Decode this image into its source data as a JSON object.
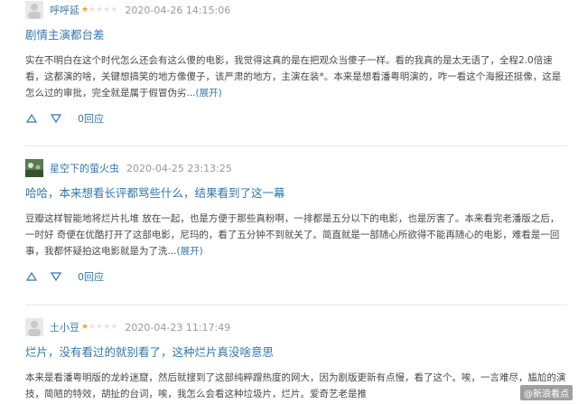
{
  "reviews": [
    {
      "author": "呼呼延",
      "rating": 1,
      "date": "2020-04-26 14:15:06",
      "title": "剧情主演都台差",
      "content": "实在不明白在这个时代怎么还会有这么傻的电影，我觉得这真的是在把观众当傻子一样。看的我真的是太无语了，全程2.0倍速看，这都演的啥，关键想搞笑的地方像傻子，该严肃的地方，主演在装*。本来是想看潘粤明演的，咋一看这个海报还挺像，这是怎么过的审批，完全就是属于假冒伪劣...",
      "more": "(展开)",
      "replies": "0回应"
    },
    {
      "author": "星空下的萤火虫",
      "rating": 0,
      "date": "2020-04-25 23:13:25",
      "title": "哈哈，本来想看长评都骂些什么，结果看到了这一幕",
      "content": "豆瓣这样智能地将烂片扎堆 放在一起，也是方便于那些真粉啊，一排都是五分以下的电影，也是厉害了。本来看完老潘版之后，一时好 奇便在优酷打开了这部电影，尼玛的，看了五分钟不到就关了。简直就是一部随心所欲得不能再随心的电影，难看是一回事，我都怀疑拍这电影就是为了洗...",
      "more": "(展开)",
      "replies": "0回应"
    },
    {
      "author": "土小豆",
      "rating": 1,
      "date": "2020-04-23 11:17:49",
      "title": "烂片，没有看过的就别看了，这种烂片真没啥意思",
      "content": "本来是看潘粤明版的龙岭迷窟，然后就搜到了这部纯粹蹭热度的网大，因为剧版更新有点慢，看了这个。唉，一言难尽，尴尬的演技，简陋的特效，胡扯的台词，唉，我怎么会看这种垃圾片，烂片。爱奇艺老是推",
      "more": "",
      "replies": ""
    }
  ],
  "watermark": "@新浪看点",
  "icons": {
    "upvote": "triangle-up-icon",
    "downvote": "triangle-down-icon"
  },
  "colors": {
    "link": "#3377aa",
    "star_on": "#f5a623",
    "star_off": "#e3e3e3",
    "text": "#494949",
    "meta": "#999999"
  }
}
